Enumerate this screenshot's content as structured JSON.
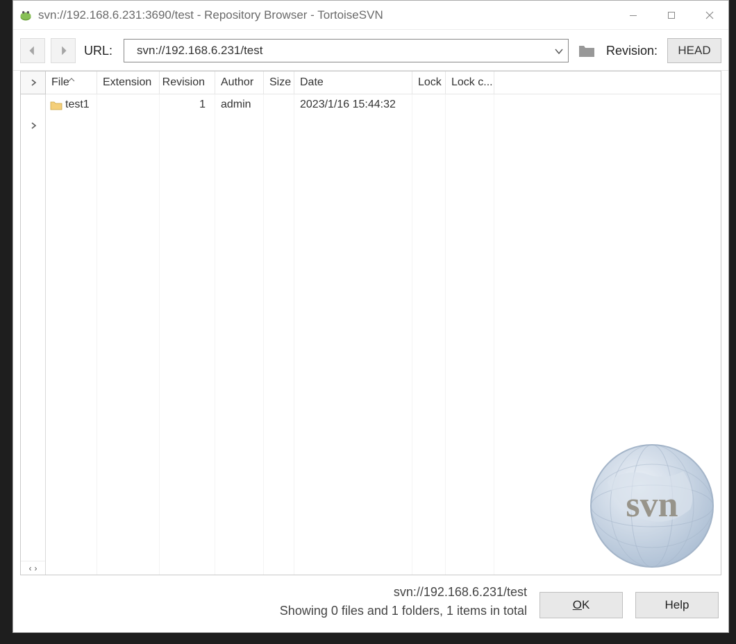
{
  "window": {
    "title": "svn://192.168.6.231:3690/test - Repository Browser - TortoiseSVN"
  },
  "toolbar": {
    "url_label": "URL:",
    "url_value": "svn://192.168.6.231/test",
    "revision_label": "Revision:",
    "head_label": "HEAD"
  },
  "columns": {
    "file": "File",
    "extension": "Extension",
    "revision": "Revision",
    "author": "Author",
    "size": "Size",
    "date": "Date",
    "lock": "Lock",
    "lock_comment": "Lock c..."
  },
  "rows": [
    {
      "file": "test1",
      "extension": "",
      "revision": "1",
      "author": "admin",
      "size": "",
      "date": "2023/1/16 15:44:32",
      "lock": "",
      "lock_comment": "",
      "is_folder": true
    }
  ],
  "status": {
    "path": "svn://192.168.6.231/test",
    "summary": "Showing 0 files and 1 folders, 1 items in total"
  },
  "buttons": {
    "ok": "OK",
    "help": "Help"
  },
  "tree_nav": {
    "left": "‹",
    "right": "›"
  },
  "watermark_text": "svn"
}
